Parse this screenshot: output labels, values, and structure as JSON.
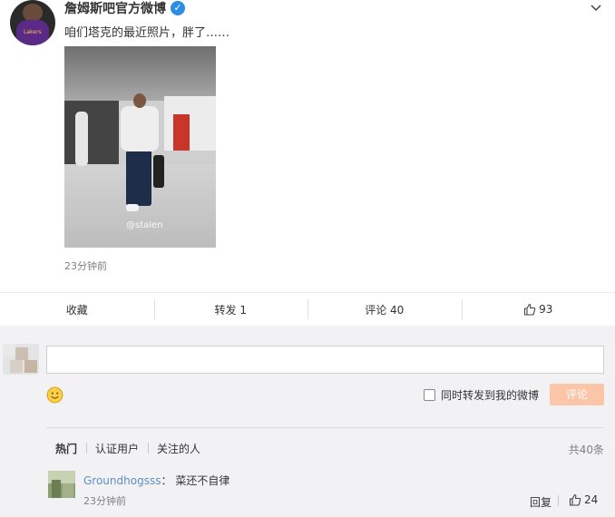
{
  "post": {
    "author": "詹姆斯吧官方微博",
    "verified_mark": "✓",
    "avatar_text": "Lakers",
    "content": "咱们塔克的最近照片，胖了……",
    "image_watermark": "@stalen",
    "time": "23分钟前",
    "icons": {
      "verified": "verified-icon",
      "menu": "chevron-down-icon",
      "like": "thumbs-up-icon"
    }
  },
  "actions": {
    "favorite": "收藏",
    "repost": "转发 1",
    "comment": "评论 40",
    "like_count": "93"
  },
  "composer": {
    "placeholder": "",
    "repost_checkbox_label": "同时转发到我的微博",
    "submit_label": "评论",
    "emoji_icon": "smile-icon"
  },
  "comment_tabs": [
    "热门",
    "认证用户",
    "关注的人"
  ],
  "comment_total": "共40条",
  "comments": [
    {
      "user": "Groundhogsss",
      "sep": "：",
      "text": "菜还不自律",
      "time": "23分钟前",
      "reply": "回复",
      "likes": "24"
    }
  ],
  "colors": {
    "submit": "#fac6a7",
    "username": "#5d8fc3",
    "verified": "#2d8ce6",
    "panel": "#f2f2f5"
  }
}
